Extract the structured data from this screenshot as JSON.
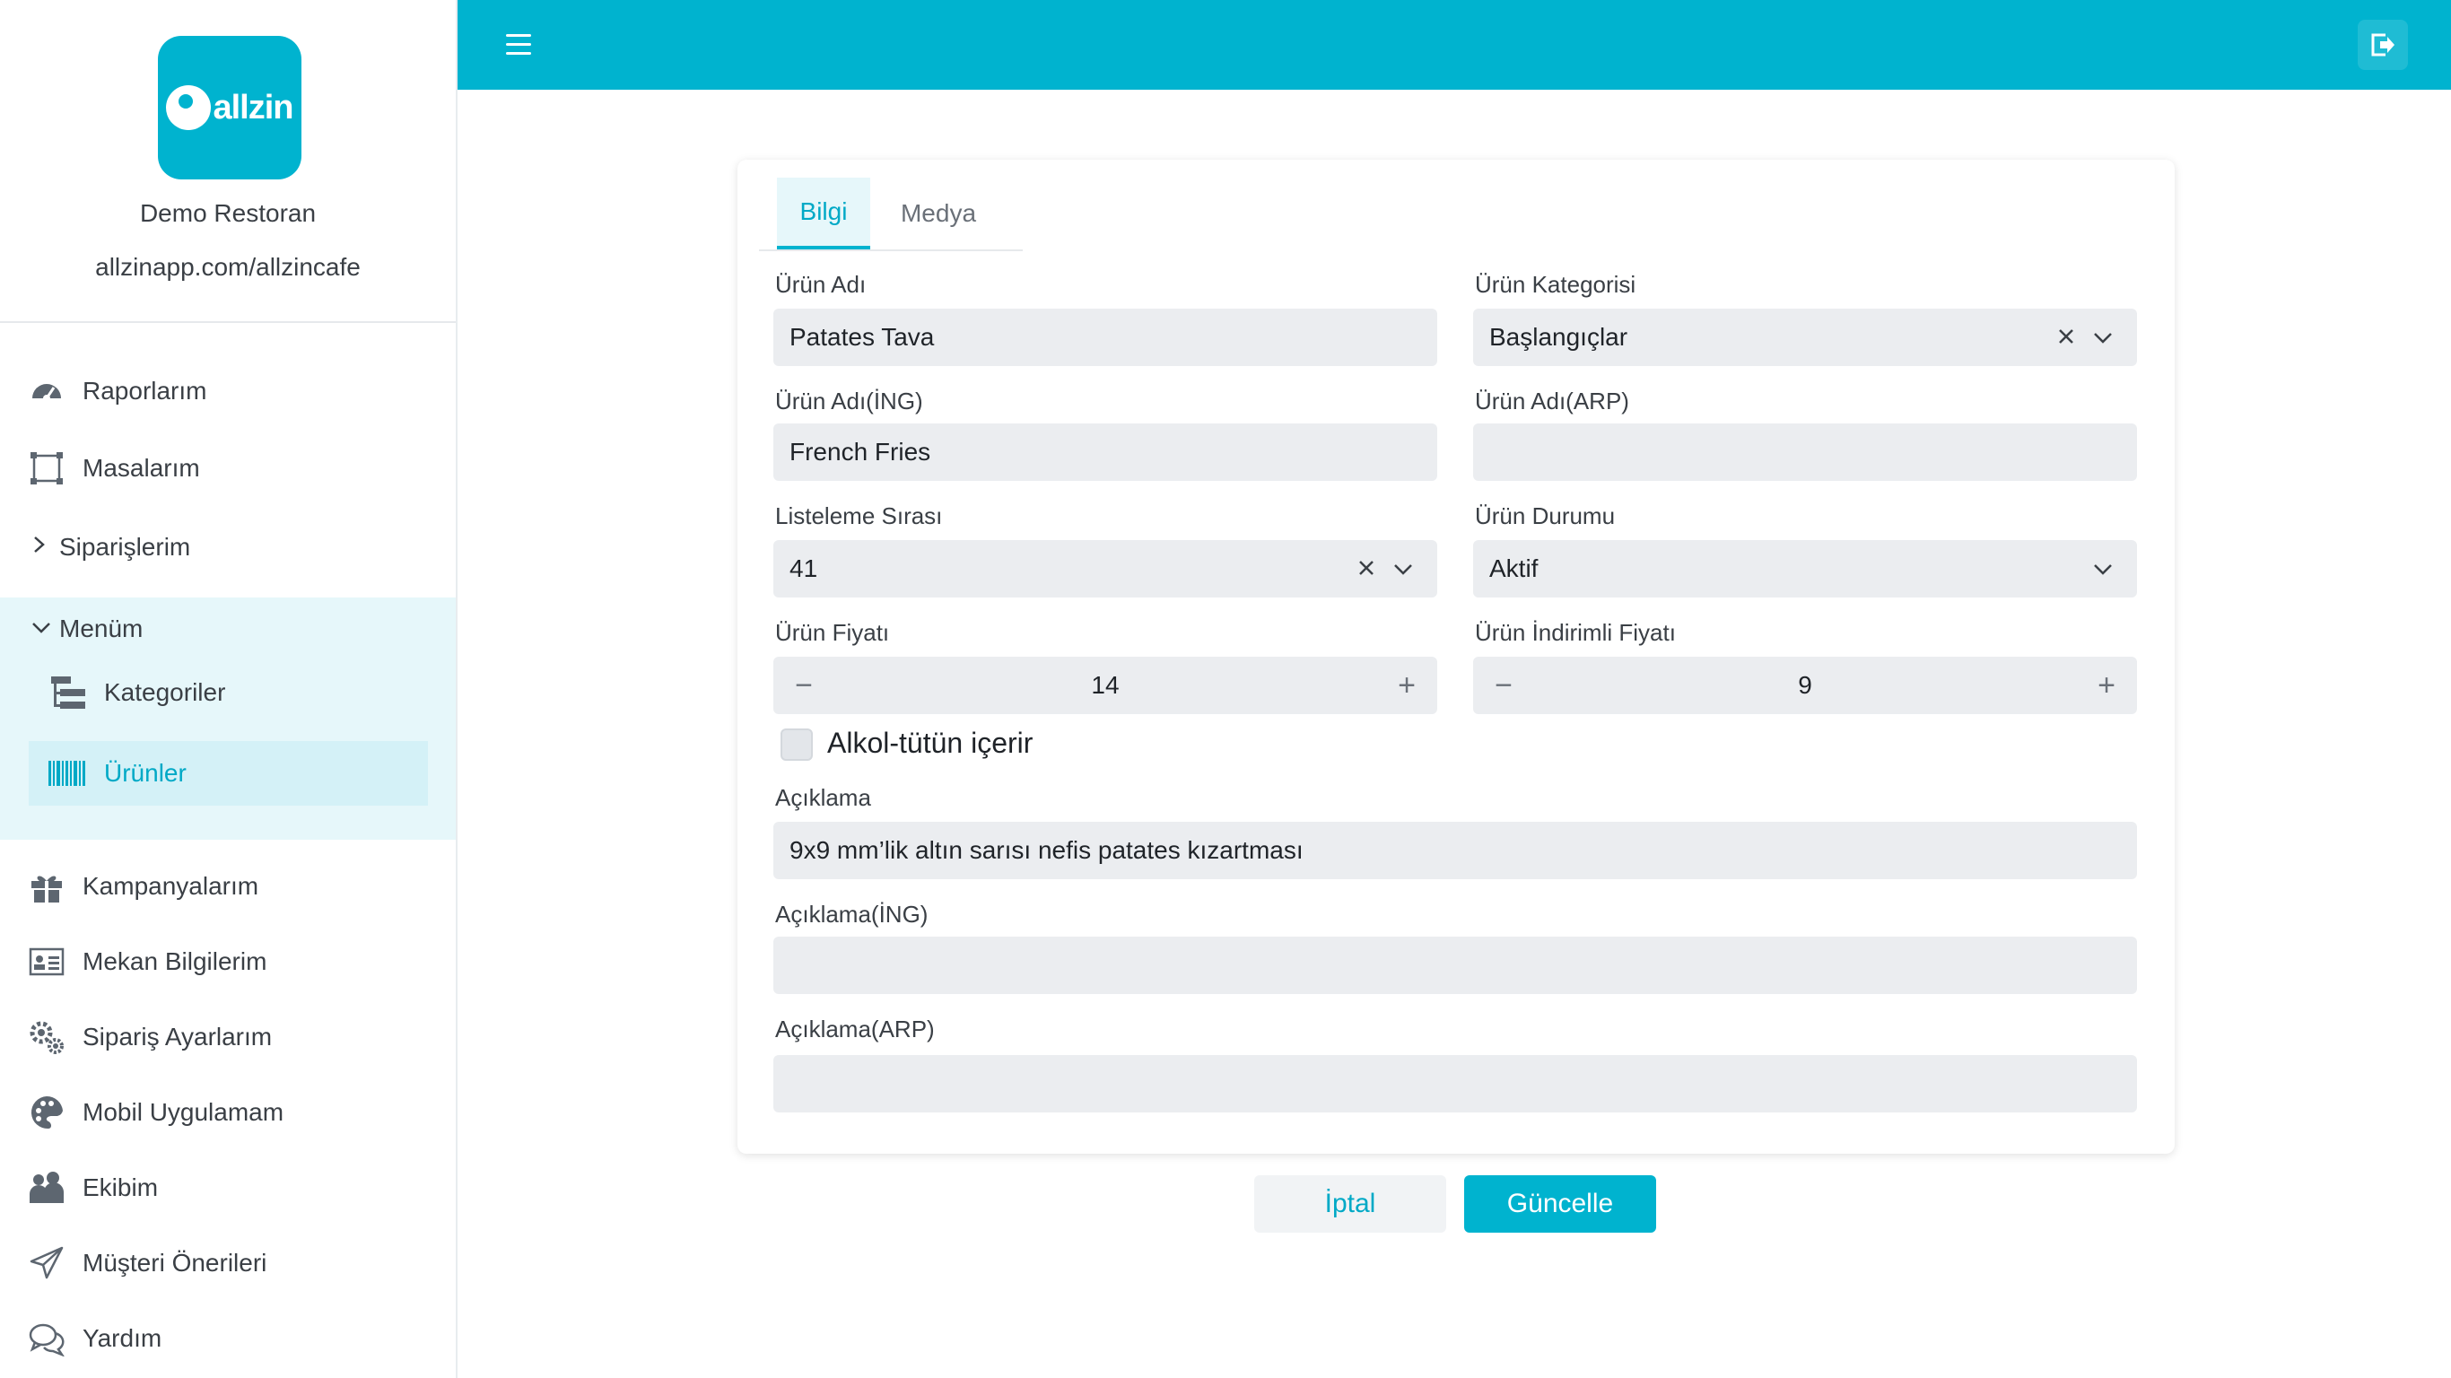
{
  "brand": {
    "logo_text": "allzin",
    "restaurant_name": "Demo Restoran",
    "restaurant_url": "allzinapp.com/allzincafe"
  },
  "sidebar": {
    "reports": "Raporlarım",
    "tables": "Masalarım",
    "orders": "Siparişlerim",
    "menu": "Menüm",
    "categories": "Kategoriler",
    "products": "Ürünler",
    "campaigns": "Kampanyalarım",
    "venue_info": "Mekan Bilgilerim",
    "order_settings": "Sipariş Ayarlarım",
    "mobile_app": "Mobil Uygulamam",
    "team": "Ekibim",
    "suggestions": "Müşteri Önerileri",
    "help": "Yardım"
  },
  "tabs": {
    "info": "Bilgi",
    "media": "Medya"
  },
  "form": {
    "name_label": "Ürün Adı",
    "name_value": "Patates Tava",
    "category_label": "Ürün Kategorisi",
    "category_value": "Başlangıçlar",
    "name_en_label": "Ürün Adı(İNG)",
    "name_en_value": "French Fries",
    "name_ar_label": "Ürün Adı(ARP)",
    "name_ar_value": "",
    "order_label": "Listeleme Sırası",
    "order_value": "41",
    "status_label": "Ürün Durumu",
    "status_value": "Aktif",
    "price_label": "Ürün Fiyatı",
    "price_value": "14",
    "discount_label": "Ürün İndirimli Fiyatı",
    "discount_value": "9",
    "alcohol_label": "Alkol-tütün içerir",
    "desc_label": "Açıklama",
    "desc_value": "9x9 mm’lik altın sarısı nefis patates kızartması",
    "desc_en_label": "Açıklama(İNG)",
    "desc_en_value": "",
    "desc_ar_label": "Açıklama(ARP)",
    "desc_ar_value": ""
  },
  "buttons": {
    "cancel": "İptal",
    "update": "Güncelle"
  },
  "colors": {
    "accent": "#00b3cf",
    "field_bg": "#ebedf0"
  }
}
